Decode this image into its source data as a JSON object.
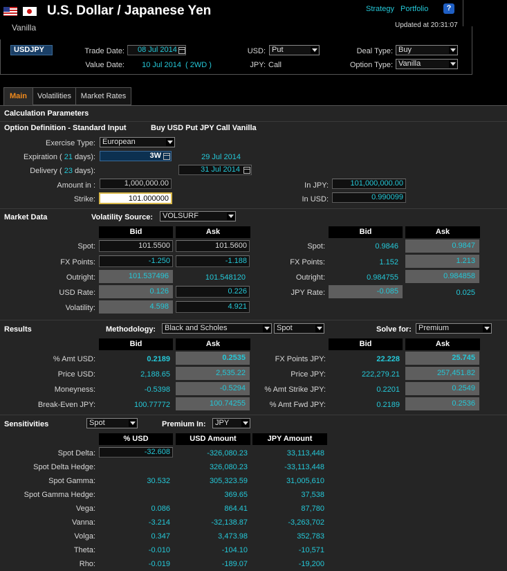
{
  "header": {
    "title": "U.S. Dollar / Japanese Yen",
    "subtitle": "Vanilla",
    "strategy": "Strategy",
    "portfolio": "Portfolio",
    "help": "?",
    "updated": "Updated at 20:31:07"
  },
  "deal": {
    "pair": "USDJPY",
    "trade_date_label": "Trade Date:",
    "trade_date": "08 Jul 2014",
    "value_date_label": "Value Date:",
    "value_date": "10 Jul 2014",
    "value_tenor": "( 2WD )",
    "usd_label": "USD:",
    "usd_value": "Put",
    "jpy_label": "JPY:",
    "jpy_value": "Call",
    "deal_type_label": "Deal Type:",
    "deal_type": "Buy",
    "option_type_label": "Option Type:",
    "option_type": "Vanilla"
  },
  "tabs": [
    "Main",
    "Volatilities",
    "Market Rates"
  ],
  "calc": {
    "title": "Calculation Parameters",
    "opt_def": "Option Definition - Standard Input",
    "opt_desc": "Buy USD Put JPY Call Vanilla",
    "exercise_label": "Exercise Type:",
    "exercise": "European",
    "exp_label_a": "Expiration (",
    "exp_days": "21",
    "exp_label_b": "days):",
    "exp_tenor": "3W",
    "exp_date": "29 Jul 2014",
    "del_label_a": "Delivery (",
    "del_days": "23",
    "del_label_b": "days):",
    "del_date": "31 Jul 2014",
    "amount_label": "Amount in :",
    "amount": "1,000,000.00",
    "strike_label": "Strike:",
    "strike": "101.000000",
    "injpy_label": "In JPY:",
    "injpy": "101,000,000.00",
    "inusd_label": "In USD:",
    "inusd": "0.990099"
  },
  "market": {
    "title": "Market Data",
    "vol_source_label": "Volatility Source:",
    "vol_source": "VOLSURF",
    "bid": "Bid",
    "ask": "Ask",
    "left": [
      {
        "label": "Spot:",
        "bid": "101.5500",
        "ask": "101.5600"
      },
      {
        "label": "FX Points:",
        "bid": "-1.250",
        "ask": "-1.188"
      },
      {
        "label": "Outright:",
        "bid": "101.537496",
        "ask": "101.548120"
      },
      {
        "label": "USD Rate:",
        "bid": "0.126",
        "ask": "0.226"
      },
      {
        "label": "Volatility:",
        "bid": "4.598",
        "ask": "4.921"
      }
    ],
    "right": [
      {
        "label": "Spot:",
        "bid": "0.9846",
        "ask": "0.9847"
      },
      {
        "label": "FX Points:",
        "bid": "1.152",
        "ask": "1.213"
      },
      {
        "label": "Outright:",
        "bid": "0.984755",
        "ask": "0.984858"
      },
      {
        "label": "JPY Rate:",
        "bid": "-0.085",
        "ask": "0.025"
      }
    ]
  },
  "results": {
    "title": "Results",
    "method_label": "Methodology:",
    "method": "Black and Scholes",
    "spot": "Spot",
    "solve_label": "Solve for:",
    "solve": "Premium",
    "bid": "Bid",
    "ask": "Ask",
    "left": [
      {
        "label": "% Amt USD:",
        "bid": "0.2189",
        "ask": "0.2535"
      },
      {
        "label": "Price USD:",
        "bid": "2,188.65",
        "ask": "2,535.22"
      },
      {
        "label": "Moneyness:",
        "bid": "-0.5398",
        "ask": "-0.5294"
      },
      {
        "label": "Break-Even JPY:",
        "bid": "100.77772",
        "ask": "100.74255"
      }
    ],
    "right": [
      {
        "label": "FX Points JPY:",
        "bid": "22.228",
        "ask": "25.745"
      },
      {
        "label": "Price JPY:",
        "bid": "222,279.21",
        "ask": "257,451.82"
      },
      {
        "label": "% Amt Strike JPY:",
        "bid": "0.2201",
        "ask": "0.2549"
      },
      {
        "label": "% Amt Fwd JPY:",
        "bid": "0.2189",
        "ask": "0.2536"
      }
    ]
  },
  "sens": {
    "title": "Sensitivities",
    "spot": "Spot",
    "premium_label": "Premium In:",
    "premium": "JPY",
    "col1": "% USD",
    "col2": "USD Amount",
    "col3": "JPY Amount",
    "rows": [
      {
        "label": "Spot Delta:",
        "pct": "-32.608",
        "usd": "-326,080.23",
        "jpy": "33,113,448"
      },
      {
        "label": "Spot Delta Hedge:",
        "pct": "",
        "usd": "326,080.23",
        "jpy": "-33,113,448"
      },
      {
        "label": "Spot Gamma:",
        "pct": "30.532",
        "usd": "305,323.59",
        "jpy": "31,005,610"
      },
      {
        "label": "Spot Gamma Hedge:",
        "pct": "",
        "usd": "369.65",
        "jpy": "37,538"
      },
      {
        "label": "Vega:",
        "pct": "0.086",
        "usd": "864.41",
        "jpy": "87,780"
      },
      {
        "label": "Vanna:",
        "pct": "-3.214",
        "usd": "-32,138.87",
        "jpy": "-3,263,702"
      },
      {
        "label": "Volga:",
        "pct": "0.347",
        "usd": "3,473.98",
        "jpy": "352,783"
      },
      {
        "label": "Theta:",
        "pct": "-0.010",
        "usd": "-104.10",
        "jpy": "-10,571"
      },
      {
        "label": "Rho:",
        "pct": "-0.019",
        "usd": "-189.07",
        "jpy": "-19,200"
      }
    ]
  }
}
